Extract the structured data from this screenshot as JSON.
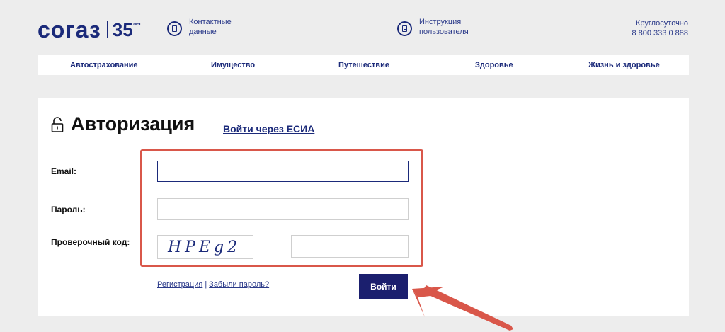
{
  "header": {
    "logo_text": "согаз",
    "logo_anniversary": "35",
    "logo_anniversary_suffix": "лет",
    "contacts": {
      "line1": "Контактные",
      "line2": "данные"
    },
    "instructions": {
      "line1": "Инструкция",
      "line2": "пользователя"
    },
    "support": {
      "line1": "Круглосуточно",
      "line2": "8 800 333 0 888"
    }
  },
  "nav": {
    "items": [
      {
        "label": "Автострахование"
      },
      {
        "label": "Имущество"
      },
      {
        "label": "Путешествие"
      },
      {
        "label": "Здоровье"
      },
      {
        "label": "Жизнь и здоровье"
      }
    ]
  },
  "auth": {
    "title": "Авторизация",
    "esia_link": "Войти через ЕСИА",
    "email_label": "Email:",
    "email_value": "",
    "password_label": "Пароль:",
    "password_value": "",
    "captcha_label": "Проверочный код:",
    "captcha_image_text": "HPEg2",
    "captcha_value": "",
    "register_link": "Регистрация",
    "link_separator": "|",
    "forgot_link": "Забыли пароль?",
    "login_button": "Войти"
  },
  "colors": {
    "brand": "#1b2a7a",
    "button": "#1b1f6e",
    "highlight": "#d9574a",
    "background": "#ededed"
  }
}
